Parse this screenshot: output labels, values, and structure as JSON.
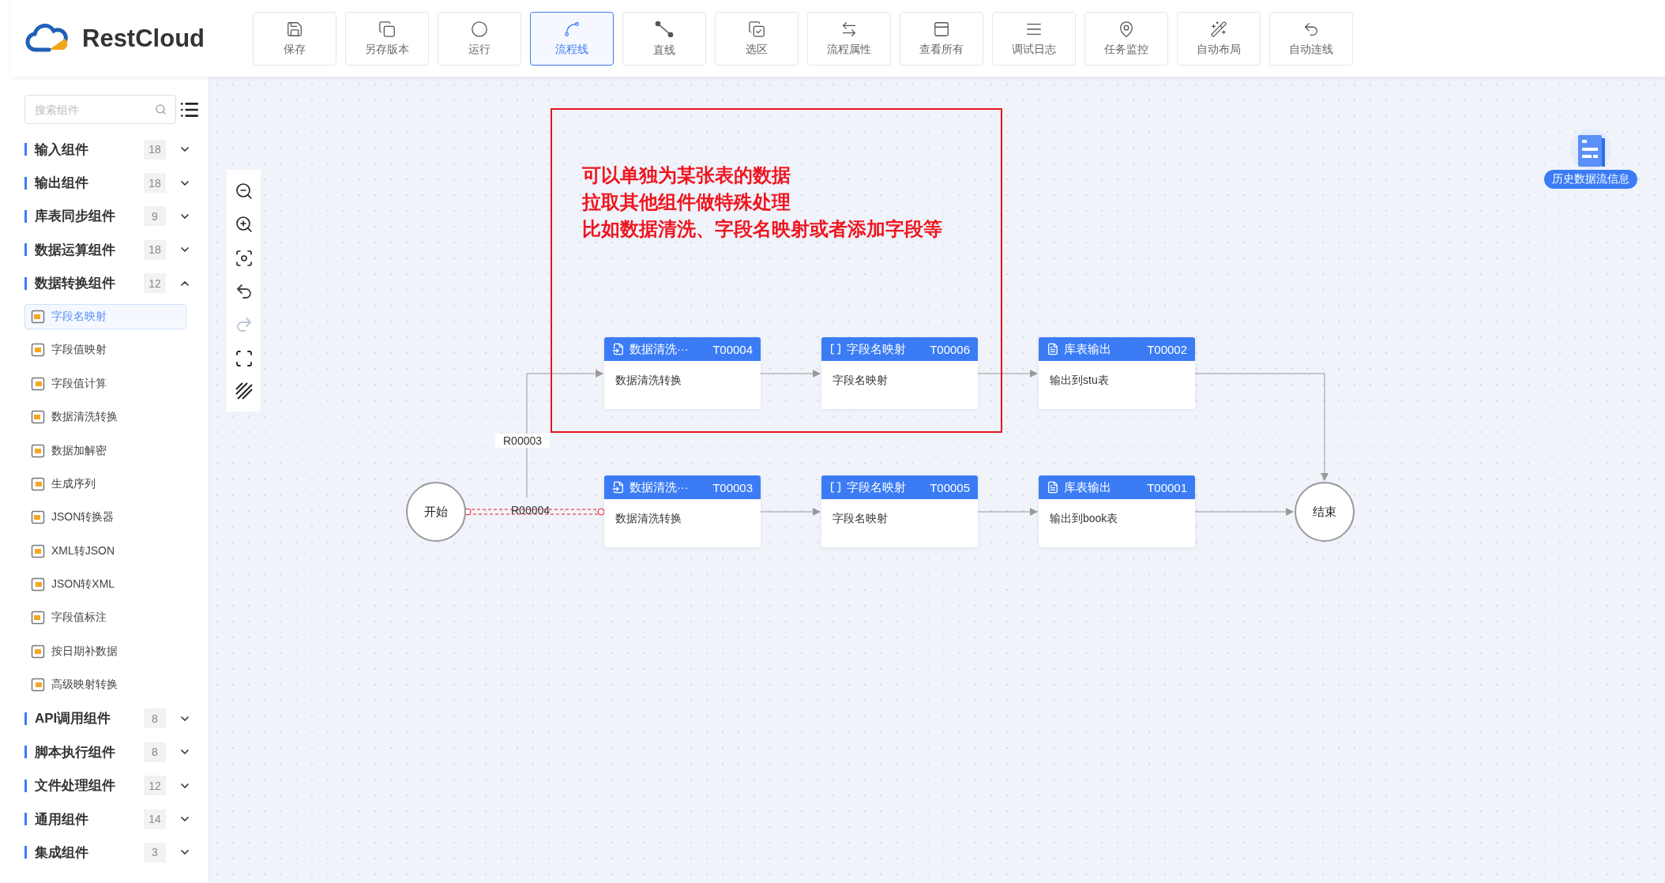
{
  "header": {
    "logo": "RestCloud",
    "tools": [
      {
        "label": "保存",
        "selected": false
      },
      {
        "label": "另存版本",
        "selected": false
      },
      {
        "label": "运行",
        "selected": false
      },
      {
        "label": "流程线",
        "selected": true
      },
      {
        "label": "直线",
        "selected": false
      },
      {
        "label": "选区",
        "selected": false
      },
      {
        "label": "流程属性",
        "selected": false
      },
      {
        "label": "查看所有",
        "selected": false
      },
      {
        "label": "调试日志",
        "selected": false
      },
      {
        "label": "任务监控",
        "selected": false
      },
      {
        "label": "自动布局",
        "selected": false
      },
      {
        "label": "自动连线",
        "selected": false
      }
    ]
  },
  "sidebar": {
    "search": {
      "placeholder": "搜索组件"
    },
    "groups": [
      {
        "label": "输入组件",
        "count": "18",
        "expanded": false
      },
      {
        "label": "输出组件",
        "count": "18",
        "expanded": false
      },
      {
        "label": "库表同步组件",
        "count": "9",
        "expanded": false
      },
      {
        "label": "数据运算组件",
        "count": "18",
        "expanded": false
      },
      {
        "label": "数据转换组件",
        "count": "12",
        "expanded": true,
        "items": [
          {
            "label": "字段名映射",
            "selected": true
          },
          {
            "label": "字段值映射",
            "selected": false
          },
          {
            "label": "字段值计算",
            "selected": false
          },
          {
            "label": "数据清洗转换",
            "selected": false
          },
          {
            "label": "数据加解密",
            "selected": false
          },
          {
            "label": "生成序列",
            "selected": false
          },
          {
            "label": "JSON转换器",
            "selected": false
          },
          {
            "label": "XML转JSON",
            "selected": false
          },
          {
            "label": "JSON转XML",
            "selected": false
          },
          {
            "label": "字段值标注",
            "selected": false
          },
          {
            "label": "按日期补数据",
            "selected": false
          },
          {
            "label": "高级映射转换",
            "selected": false
          }
        ]
      },
      {
        "label": "API调用组件",
        "count": "8",
        "expanded": false
      },
      {
        "label": "脚本执行组件",
        "count": "8",
        "expanded": false
      },
      {
        "label": "文件处理组件",
        "count": "12",
        "expanded": false
      },
      {
        "label": "通用组件",
        "count": "14",
        "expanded": false
      },
      {
        "label": "集成组件",
        "count": "3",
        "expanded": false
      }
    ]
  },
  "canvas": {
    "start": "开始",
    "end": "结束",
    "note": [
      "可以单独为某张表的数据",
      "拉取其他组件做特殊处理",
      "比如数据清洗、字段名映射或者添加字段等"
    ],
    "rows": [
      {
        "edge": {
          "label": "R00003",
          "selected": false
        },
        "nodes": [
          {
            "kind": "clean",
            "title": "数据清洗···",
            "id": "T00004",
            "body": "数据清洗转换"
          },
          {
            "kind": "map",
            "title": "字段名映射",
            "id": "T00006",
            "body": "字段名映射"
          },
          {
            "kind": "output",
            "title": "库表输出",
            "id": "T00002",
            "body": "输出到stu表"
          }
        ]
      },
      {
        "edge": {
          "label": "R00004",
          "selected": true
        },
        "nodes": [
          {
            "kind": "clean",
            "title": "数据清洗···",
            "id": "T00003",
            "body": "数据清洗转换"
          },
          {
            "kind": "map",
            "title": "字段名映射",
            "id": "T00005",
            "body": "字段名映射"
          },
          {
            "kind": "output",
            "title": "库表输出",
            "id": "T00001",
            "body": "输出到book表"
          }
        ]
      }
    ],
    "history_badge": "历史数据流信息"
  }
}
